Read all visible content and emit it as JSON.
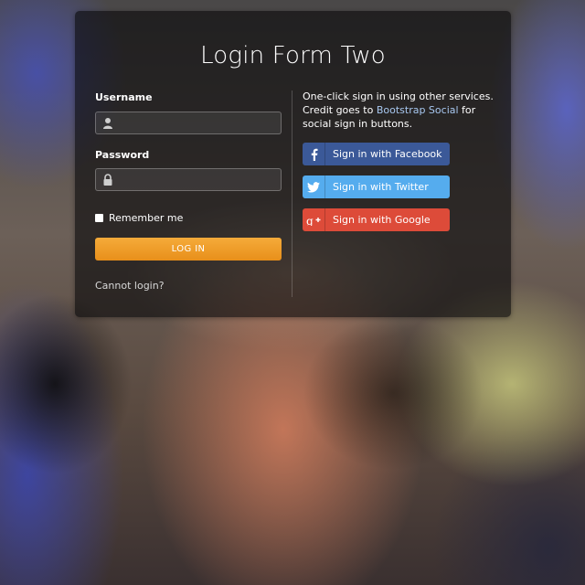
{
  "page": {
    "title": "Login Form Two"
  },
  "form": {
    "username_label": "Username",
    "username_value": "",
    "password_label": "Password",
    "password_value": "",
    "remember_label": "Remember me",
    "remember_checked": false,
    "login_label": "LOG IN",
    "cannot_login": "Cannot login?"
  },
  "social": {
    "text_before": "One-click sign in using other services. Credit goes to ",
    "link_text": "Bootstrap Social",
    "text_after": " for social sign in buttons.",
    "buttons": [
      {
        "label": "Sign in with Facebook",
        "icon": "facebook-icon",
        "color": "#3b5998"
      },
      {
        "label": "Sign in with Twitter",
        "icon": "twitter-icon",
        "color": "#55acee"
      },
      {
        "label": "Sign in with Google",
        "icon": "google-plus-icon",
        "color": "#dd4b39"
      }
    ]
  },
  "colors": {
    "accent": "#f0a030",
    "link": "#a8c8f0"
  }
}
